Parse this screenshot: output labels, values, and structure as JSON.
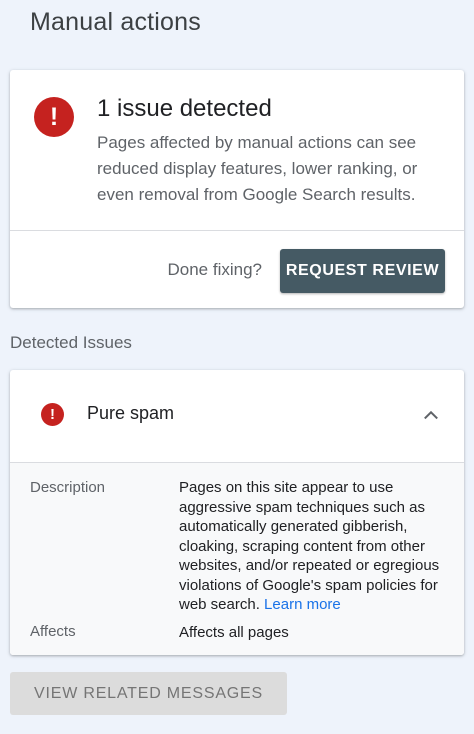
{
  "page": {
    "title": "Manual actions"
  },
  "issue_card": {
    "title": "1 issue detected",
    "description": "Pages affected by manual actions can see reduced display features, lower ranking, or even removal from Google Search results.",
    "done_fixing_label": "Done fixing?",
    "request_review_label": "REQUEST REVIEW",
    "icon": "error-exclamation-icon",
    "icon_color": "#c5221f",
    "button_color": "#455a64"
  },
  "detected_issues": {
    "heading": "Detected Issues",
    "items": [
      {
        "title": "Pure spam",
        "expanded": true,
        "description_label": "Description",
        "description_text": "Pages on this site appear to use aggressive spam techniques such as automatically generated gibberish, cloaking, scraping content from other websites, and/or repeated or egregious violations of Google's spam policies for web search.",
        "learn_more_label": "Learn more",
        "affects_label": "Affects",
        "affects_value": "Affects all pages"
      }
    ]
  },
  "footer": {
    "view_related_label": "VIEW RELATED MESSAGES"
  },
  "colors": {
    "background": "#eef3fb",
    "link": "#1a73e8"
  }
}
